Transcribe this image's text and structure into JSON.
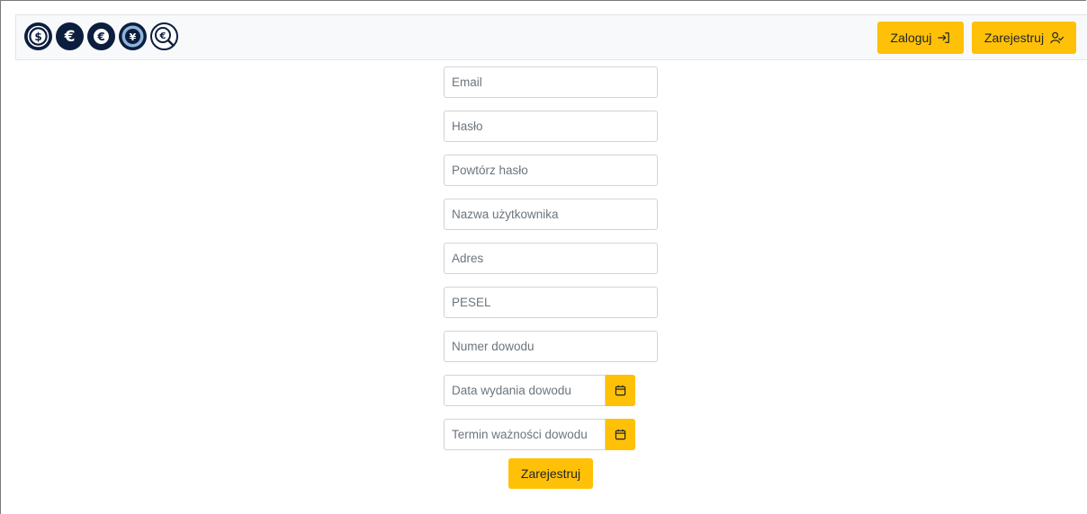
{
  "navbar": {
    "logos": [
      {
        "icon": "dollar-coin-icon"
      },
      {
        "icon": "euro-coin-icon"
      },
      {
        "icon": "euro-coin-icon"
      },
      {
        "icon": "yen-coin-icon"
      },
      {
        "icon": "euro-search-icon"
      }
    ],
    "login_label": "Zaloguj",
    "login_icon": "sign-in-icon",
    "register_label": "Zarejestruj",
    "register_icon": "person-check-icon"
  },
  "form": {
    "email": {
      "placeholder": "Email",
      "value": ""
    },
    "password": {
      "placeholder": "Hasło",
      "value": ""
    },
    "password_repeat": {
      "placeholder": "Powtórz hasło",
      "value": ""
    },
    "username": {
      "placeholder": "Nazwa użytkownika",
      "value": ""
    },
    "address": {
      "placeholder": "Adres",
      "value": ""
    },
    "pesel": {
      "placeholder": "PESEL",
      "value": ""
    },
    "id_number": {
      "placeholder": "Numer dowodu",
      "value": ""
    },
    "id_issue_date": {
      "placeholder": "Data wydania dowodu",
      "value": "",
      "button_icon": "calendar-icon"
    },
    "id_expiry_date": {
      "placeholder": "Termin ważności dowodu",
      "value": "",
      "button_icon": "calendar-icon"
    },
    "submit_label": "Zarejestruj"
  },
  "colors": {
    "accent": "#ffc107",
    "navbar_bg": "#f8f9fa",
    "logo_navy": "#0b1e3d",
    "placeholder": "#6c757d"
  }
}
